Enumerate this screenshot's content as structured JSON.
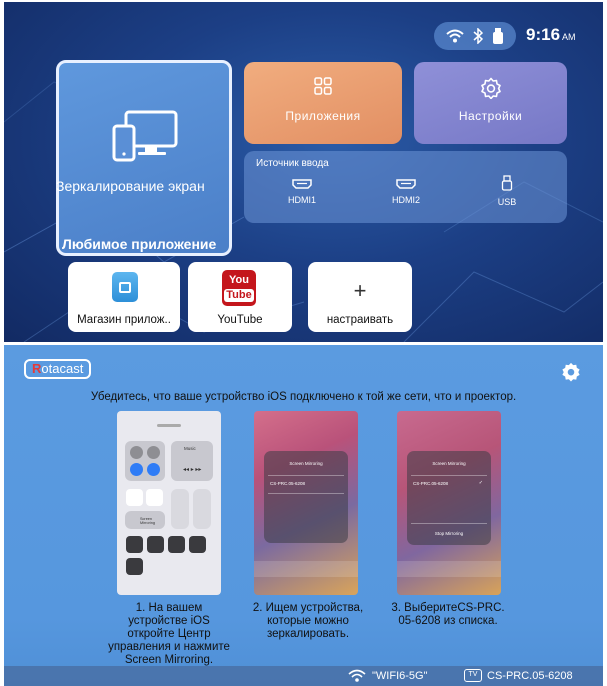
{
  "launcher": {
    "status": {
      "icons": [
        "wifi-icon",
        "bluetooth-icon",
        "usb-drive-icon"
      ],
      "time": "9:16",
      "ampm": "AM"
    },
    "tiles": {
      "mirror_label": "Зеркалирование экран",
      "apps_label": "Приложения",
      "settings_label": "Настройки"
    },
    "input_source": {
      "title": "Источник ввода",
      "items": [
        {
          "label": "HDMI1",
          "icon": "hdmi-icon"
        },
        {
          "label": "HDMI2",
          "icon": "hdmi-icon"
        },
        {
          "label": "USB",
          "icon": "usb-icon"
        }
      ]
    },
    "favorites": {
      "title": "Любимое приложение",
      "items": [
        {
          "label": "Магазин прилож..",
          "icon": "app-store-icon"
        },
        {
          "label": "YouTube",
          "icon": "youtube-icon",
          "icon_text_top": "You",
          "icon_text_bottom": "Tube"
        },
        {
          "label": "настраивать",
          "icon": "plus-icon"
        }
      ]
    },
    "colors": {
      "background": "#1c3f85",
      "apps_tile": "#e8976a",
      "settings_tile": "#8183cc",
      "mirror_tile": "#5689d2"
    }
  },
  "cast_guide": {
    "brand_first": "R",
    "brand_rest": "otacast",
    "instruction": "Убедитесь, что ваше устройство iOS подключено к той же сети, что и проектор.",
    "screenshots": {
      "control_center_music": "Music",
      "control_center_mirroring": "Screen Mirroring",
      "dialog_title": "Screen Mirroring",
      "dialog_device": "CS-PRC.05-6208",
      "dialog_stop": "Stop Mirroring"
    },
    "steps": [
      "1. На вашем устройстве iOS откройте Центр управления и нажмите Screen Mirroring.",
      "2. Ищем устройства, которые можно зеркалировать.",
      "3. ВыберитеCS-PRC. 05-6208 из списка."
    ],
    "footer": {
      "wifi_name": "\"WIFI6-5G\"",
      "tv_badge": "TV",
      "device_name": "CS-PRC.05-6208"
    },
    "colors": {
      "background": "#5b9be0",
      "brand_accent": "#e33b3b"
    }
  }
}
